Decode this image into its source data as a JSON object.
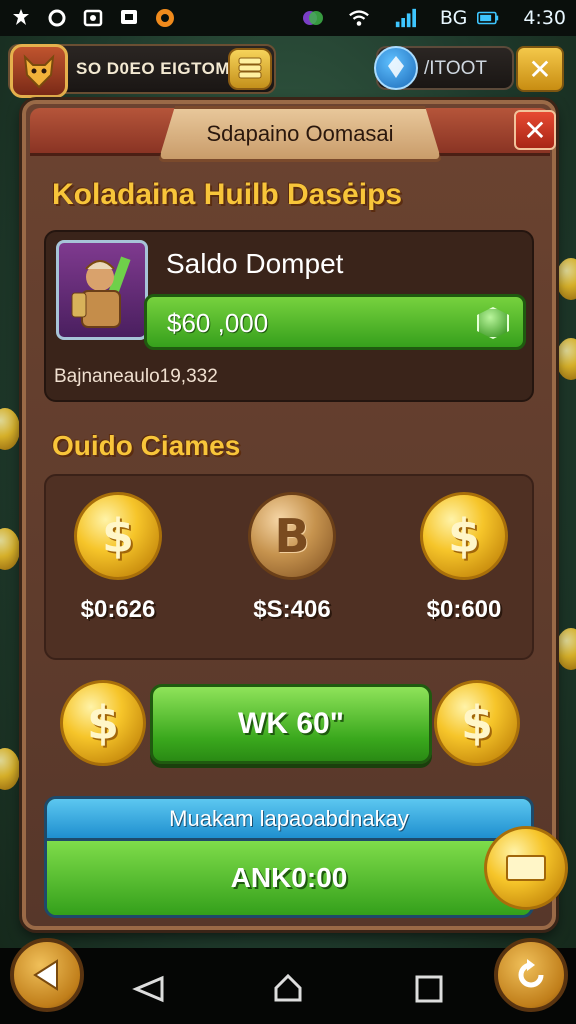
{
  "status_bar": {
    "network": "BG",
    "time": "4:30"
  },
  "hud": {
    "player_name": "SO D0EO EIGTOM",
    "gem_value": "/ITOOT",
    "close_symbol": "✕"
  },
  "panel": {
    "banner_title": "Sdapaino Oomasai",
    "close_symbol": "✕",
    "section1_title": "Koladaina Huilb Dasėips",
    "wallet": {
      "label": "Saldo Dompet",
      "value": "$60 ,000",
      "subtext": "Bajnaneaulo19,332"
    },
    "section2_title": "Ouido Ciames",
    "coins": [
      {
        "symbol": "$",
        "amount": "$0:626",
        "kind": "gold"
      },
      {
        "symbol": "B",
        "amount": "$S:406",
        "kind": "bronze"
      },
      {
        "symbol": "$",
        "amount": "$0:600",
        "kind": "gold"
      }
    ],
    "action_button": "WK 60\"",
    "side_coin_symbol": "$",
    "withdraw": {
      "title": "Muakam lapaoabdnakay",
      "value": "ANK0:00"
    }
  },
  "colors": {
    "panel": "#6b4330",
    "title_gold": "#f8c53a",
    "green_button": "#3aa81d",
    "blue_header": "#1f8fcf"
  }
}
